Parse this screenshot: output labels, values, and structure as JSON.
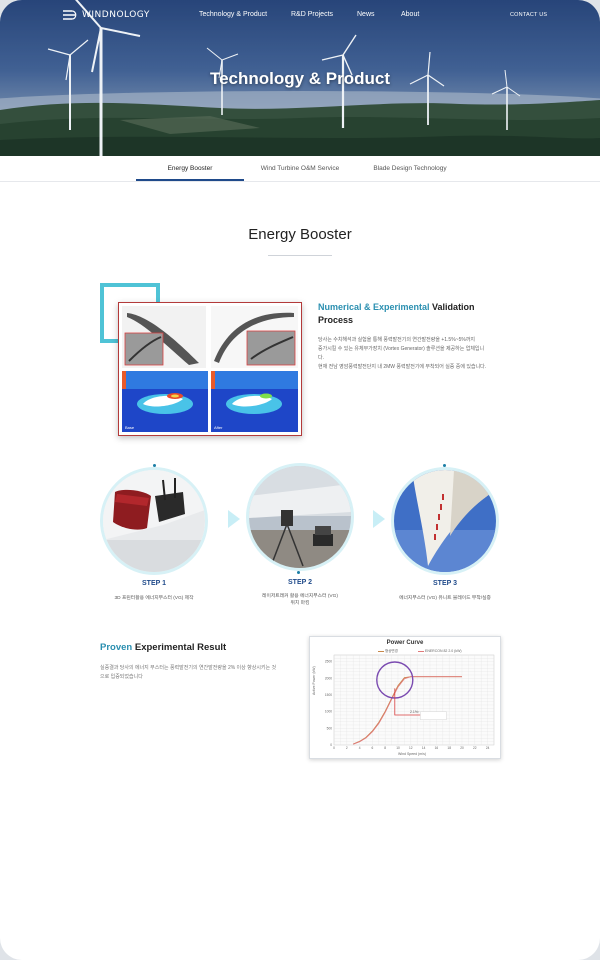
{
  "brand": {
    "logo_text": "WINDNOLOGY"
  },
  "nav": {
    "items": [
      "Technology & Product",
      "R&D Projects",
      "News",
      "About"
    ],
    "contact": "CONTACT US"
  },
  "hero": {
    "title": "Technology & Product"
  },
  "tabs": [
    "Energy Booster",
    "Wind Turbine O&M Service",
    "Blade Design Technology"
  ],
  "section": {
    "title": "Energy Booster"
  },
  "validation": {
    "title_accent": "Numerical & Experimental",
    "title_rest": " Validation",
    "title_line2": "Process",
    "body_lines": [
      "당사는 수치해석과 실험을 통해 풍력발전기의 연간발전량을 +1.5%~5%까지",
      "증가시킬 수 있는 유체부가장치 (Vortex Generator) 솔루션을 제공하는 업체입니",
      "다.",
      "현재 전남 영암풍력발전단지 내 2MW 풍력발전기에 부착되어 실증 중에 있습니다."
    ],
    "figure_tags": [
      "Base",
      "After"
    ]
  },
  "steps": [
    {
      "label": "STEP 1",
      "desc_lines": [
        "3D 프린터활용 에너지부스터 (VG) 제작"
      ]
    },
    {
      "label": "STEP 2",
      "desc_lines": [
        "레이저트래커 활용 에너지부스터 (VG)",
        "위치 마킹"
      ]
    },
    {
      "label": "STEP 3",
      "desc_lines": [
        "에너지부스터 (VG) 유니트 블레이드 부착/실증"
      ]
    }
  ],
  "proven": {
    "title_accent": "Proven",
    "title_rest": " Experimental Result",
    "body_lines": [
      "실증결과 당사의 에너지 부스터는 풍력발전기의 연간발전량을 2% 이상 향상시키는 것",
      "으로 입증되었습니다"
    ]
  },
  "power_curve": {
    "title": "Power Curve",
    "legend": [
      "형상변경",
      "ENERCON 82 2.0 (kW)"
    ],
    "ylabel": "Active Power (kW)",
    "xlabel": "Wind Speed (m/s)",
    "note": "2.1%↑",
    "colors": {
      "series1": "#c8894a",
      "series2": "#e07a7a",
      "highlight": "#7a4ab0",
      "callout": "#d94040"
    },
    "chart_data": {
      "type": "line",
      "x": [
        3,
        4,
        5,
        6,
        7,
        8,
        9,
        10,
        11,
        12,
        13,
        14,
        15,
        16,
        17,
        18,
        19,
        20
      ],
      "y_ticks": [
        0,
        500,
        1000,
        1500,
        2000,
        2500
      ],
      "x_ticks": [
        0,
        2,
        4,
        6,
        8,
        10,
        12,
        14,
        16,
        18,
        20,
        22,
        24
      ],
      "series": [
        {
          "name": "형상변경",
          "values": [
            30,
            110,
            230,
            420,
            680,
            1010,
            1400,
            1780,
            2020,
            2050,
            2050,
            2050,
            2050,
            2050,
            2050,
            2050,
            2050,
            2050
          ]
        },
        {
          "name": "ENERCON 82 2.0 (kW)",
          "values": [
            25,
            100,
            215,
            400,
            650,
            980,
            1370,
            1740,
            1990,
            2050,
            2050,
            2050,
            2050,
            2050,
            2050,
            2050,
            2050,
            2050
          ]
        }
      ],
      "xlim": [
        0,
        25
      ],
      "ylim": [
        0,
        2700
      ]
    }
  }
}
